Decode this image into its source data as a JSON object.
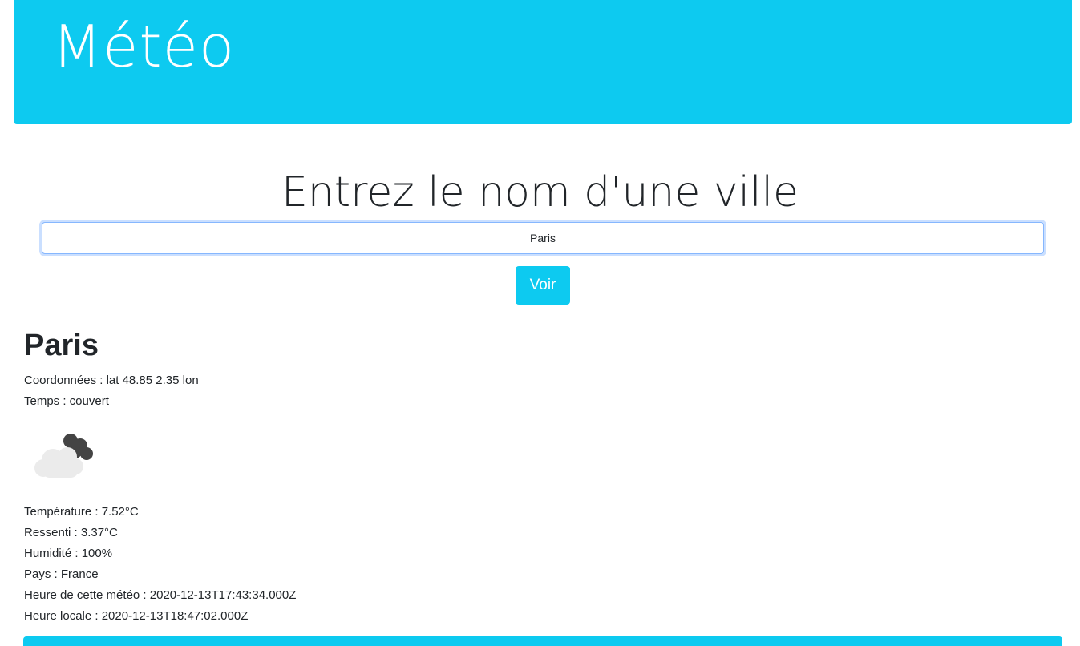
{
  "header": {
    "title": "Météo"
  },
  "search": {
    "title": "Entrez le nom d'une ville",
    "input_value": "Paris",
    "button_label": "Voir"
  },
  "result": {
    "city": "Paris",
    "coordinates": "Coordonnées : lat 48.85 2.35 lon",
    "weather": "Temps : couvert",
    "weather_icon": "overcast-clouds-icon",
    "temperature": "Température : 7.52°C",
    "feels_like": "Ressenti : 3.37°C",
    "humidity": "Humidité : 100%",
    "country": "Pays : France",
    "weather_time": "Heure de cette météo : 2020-12-13T17:43:34.000Z",
    "local_time": "Heure locale : 2020-12-13T18:47:02.000Z"
  },
  "colors": {
    "accent": "#0dcaf0",
    "text": "#212529",
    "focus_border": "#86b7fe"
  }
}
